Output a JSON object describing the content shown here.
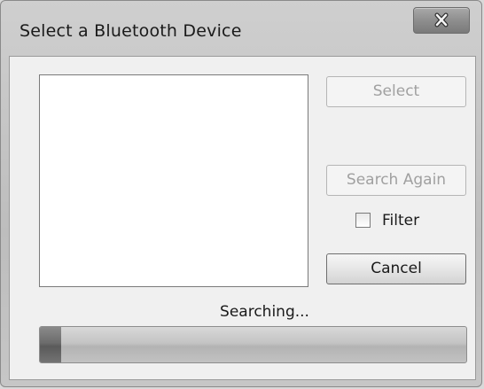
{
  "window": {
    "title": "Select a Bluetooth Device"
  },
  "titlebar": {
    "close_icon": "close-x-icon"
  },
  "device_list": {
    "items": []
  },
  "buttons": {
    "select_label": "Select",
    "search_again_label": "Search Again",
    "cancel_label": "Cancel"
  },
  "filter": {
    "label": "Filter",
    "checked": false
  },
  "status": {
    "text": "Searching..."
  },
  "progress": {
    "fraction": 0.05
  }
}
